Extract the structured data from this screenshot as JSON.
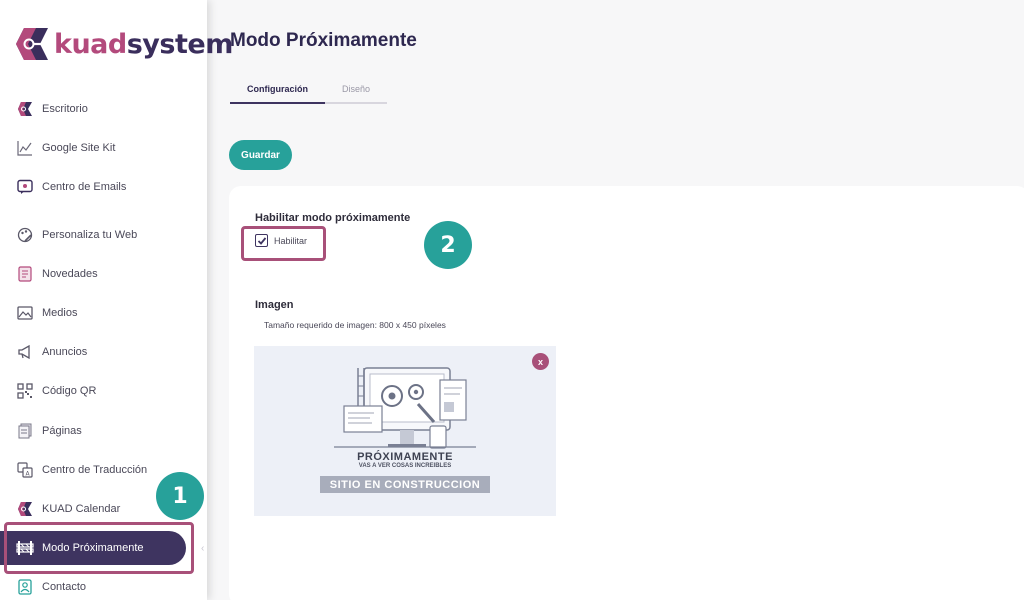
{
  "brand": {
    "kuad": "kuad",
    "system": "system"
  },
  "sidebar": {
    "items": [
      {
        "label": "Escritorio",
        "icon": "kuad-logo-icon"
      },
      {
        "label": "Google Site Kit",
        "icon": "chart-line-icon"
      },
      {
        "label": "Centro de Emails",
        "icon": "email-icon"
      },
      {
        "label": "Personaliza tu Web",
        "icon": "palette-icon"
      },
      {
        "label": "Novedades",
        "icon": "news-icon"
      },
      {
        "label": "Medios",
        "icon": "image-icon"
      },
      {
        "label": "Anuncios",
        "icon": "megaphone-icon"
      },
      {
        "label": "Código QR",
        "icon": "qr-code-icon"
      },
      {
        "label": "Páginas",
        "icon": "pages-icon"
      },
      {
        "label": "Centro de Traducción",
        "icon": "translate-icon"
      },
      {
        "label": "KUAD Calendar",
        "icon": "kuad-logo-icon"
      },
      {
        "label": "Modo Próximamente",
        "icon": "construction-icon"
      },
      {
        "label": "Contacto",
        "icon": "contact-icon"
      }
    ]
  },
  "main": {
    "title": "Modo Próximamente",
    "tabs": [
      {
        "label": "Configuración",
        "active": true
      },
      {
        "label": "Diseño",
        "active": false
      }
    ],
    "save_label": "Guardar",
    "enable_section": {
      "title": "Habilitar modo próximamente",
      "checkbox_label": "Habilitar",
      "checked": true
    },
    "image_section": {
      "title": "Imagen",
      "hint": "Tamaño requerido de imagen: 800 x 450 píxeles",
      "remove_label": "x",
      "preview": {
        "title": "PRÓXIMAMENTE",
        "subtitle": "VAS A VER COSAS INCREIBLES",
        "banner": "SITIO EN CONSTRUCCION"
      }
    }
  },
  "annotations": {
    "step1": "1",
    "step2": "2"
  },
  "colors": {
    "accent_purple": "#3e3460",
    "accent_teal": "#27a19a",
    "highlight_pink": "#a85079"
  }
}
